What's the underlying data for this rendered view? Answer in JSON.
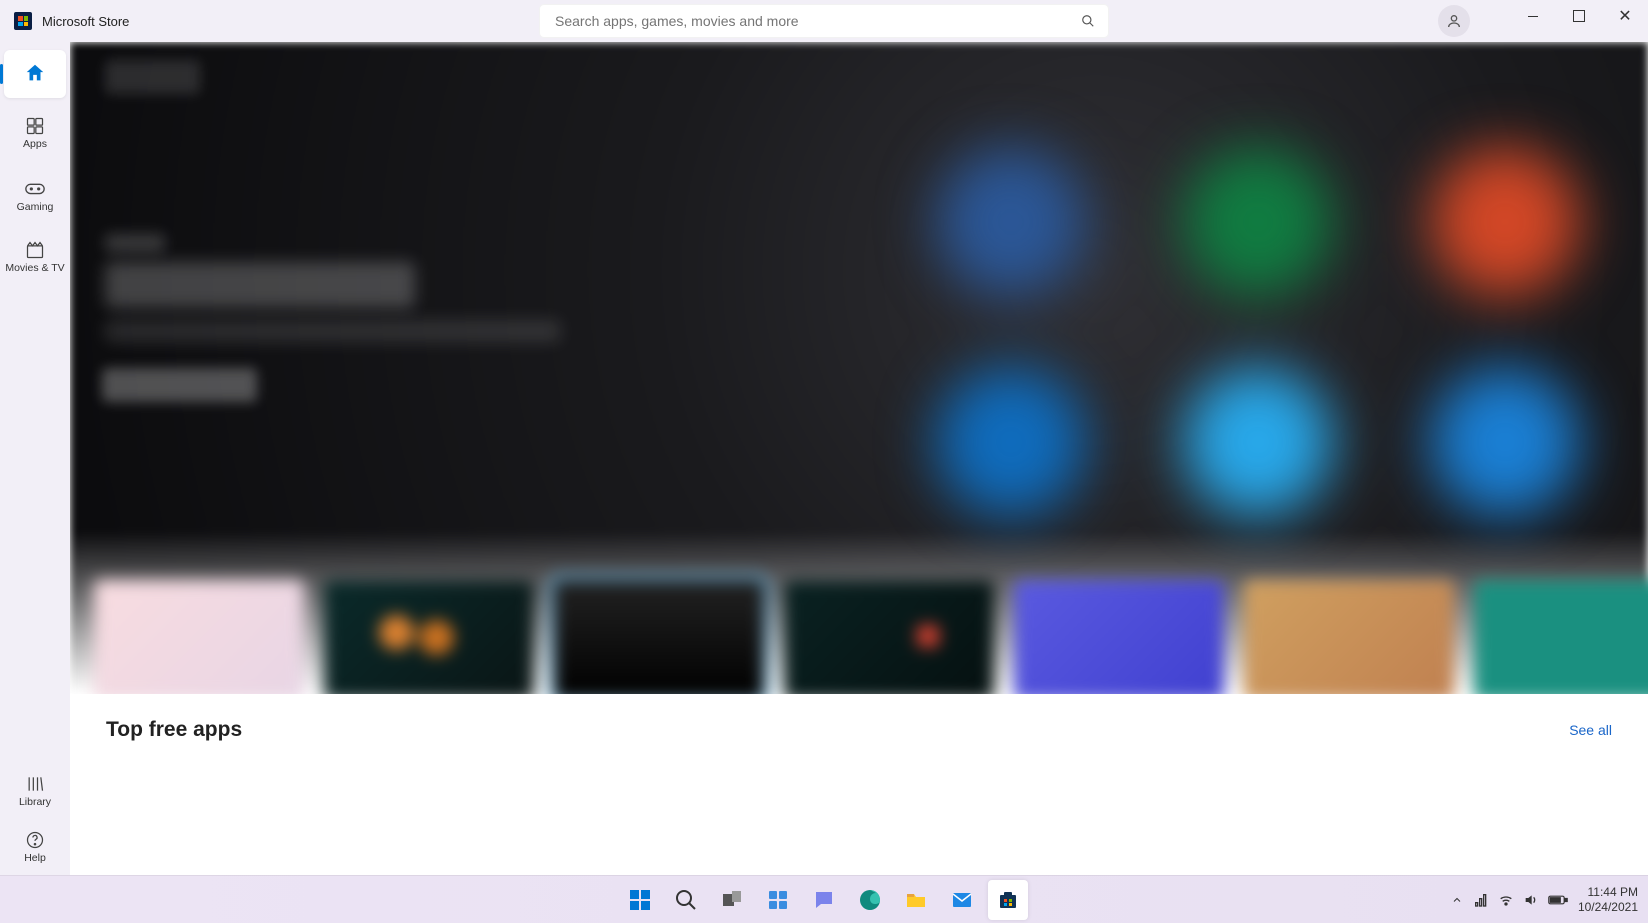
{
  "titlebar": {
    "app_name": "Microsoft Store",
    "search_placeholder": "Search apps, games, movies and more"
  },
  "sidebar": {
    "items": [
      {
        "label": "Home"
      },
      {
        "label": "Apps"
      },
      {
        "label": "Gaming"
      },
      {
        "label": "Movies & TV"
      }
    ],
    "footer": [
      {
        "label": "Library"
      },
      {
        "label": "Help"
      }
    ]
  },
  "sections": {
    "top_free_apps": {
      "title": "Top free apps",
      "see_all": "See all"
    }
  },
  "taskbar": {
    "time": "11:44 PM",
    "date": "10/24/2021"
  }
}
